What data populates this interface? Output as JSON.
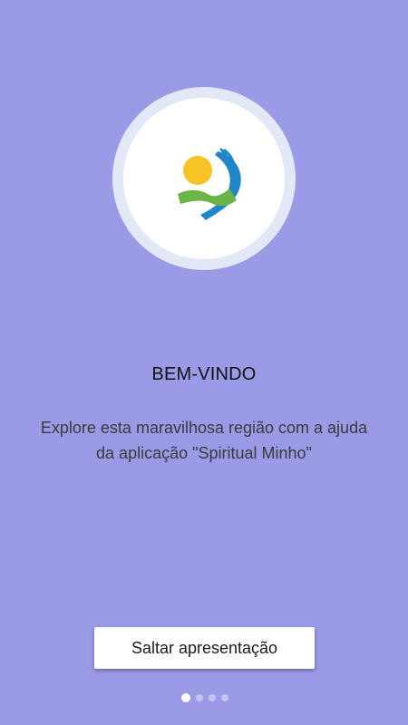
{
  "colors": {
    "background": "#9b9ae6",
    "logo_ring": "#e3e8f7",
    "logo_sun": "#f7c325",
    "logo_green": "#6ab545",
    "logo_blue": "#1f86c8",
    "dot_active": "#ffffff",
    "dot_inactive": "#c5c4ee"
  },
  "logo": {
    "icon": "spiritual-minho-logo-icon"
  },
  "intro": {
    "title": "BEM-VINDO",
    "description": "Explore esta maravilhosa região com a ajuda da aplicação \"Spiritual Minho\""
  },
  "skip_button": {
    "label": "Saltar apresentação"
  },
  "pager": {
    "page_count": 4,
    "current_page": 1
  }
}
